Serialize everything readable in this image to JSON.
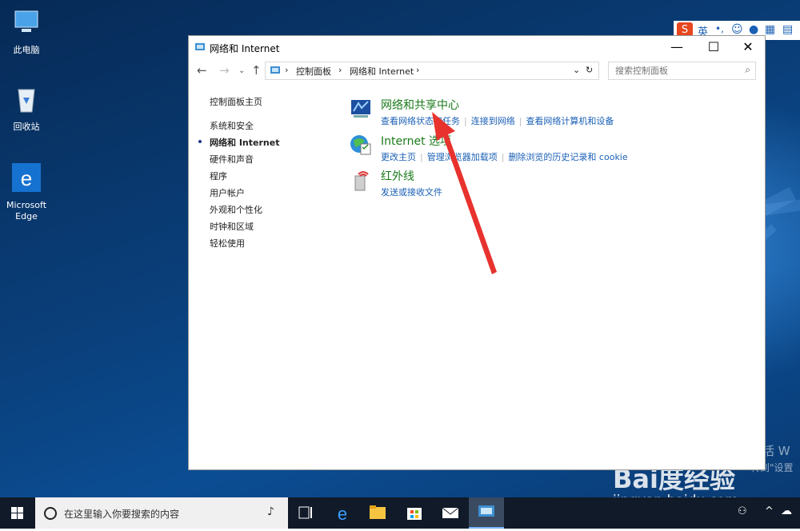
{
  "desktop": {
    "icons": [
      {
        "label": "此电脑",
        "icon": "computer-icon"
      },
      {
        "label": "回收站",
        "icon": "recycle-bin-icon"
      },
      {
        "label": "Microsoft Edge",
        "icon": "edge-icon"
      }
    ]
  },
  "window": {
    "title": "网络和 Internet",
    "controls": {
      "minimize": "—",
      "maximize": "☐",
      "close": "✕"
    },
    "breadcrumb": [
      "控制面板",
      "网络和 Internet"
    ],
    "search_placeholder": "搜索控制面板"
  },
  "sidebar": {
    "items": [
      {
        "label": "控制面板主页",
        "current": false
      },
      {
        "label": "系统和安全",
        "current": false
      },
      {
        "label": "网络和 Internet",
        "current": true
      },
      {
        "label": "硬件和声音",
        "current": false
      },
      {
        "label": "程序",
        "current": false
      },
      {
        "label": "用户帐户",
        "current": false
      },
      {
        "label": "外观和个性化",
        "current": false
      },
      {
        "label": "时钟和区域",
        "current": false
      },
      {
        "label": "轻松使用",
        "current": false
      }
    ]
  },
  "categories": [
    {
      "title": "网络和共享中心",
      "icon": "network-sharing-center-icon",
      "links": [
        "查看网络状态和任务",
        "连接到网络",
        "查看网络计算机和设备"
      ]
    },
    {
      "title": "Internet 选项",
      "icon": "internet-options-icon",
      "links": [
        "更改主页",
        "管理浏览器加载项",
        "删除浏览的历史记录和 cookie"
      ]
    },
    {
      "title": "红外线",
      "icon": "infrared-icon",
      "links": [
        "发送或接收文件"
      ]
    }
  ],
  "ime": {
    "lang": "英"
  },
  "watermarks": {
    "activate": "激活 W",
    "activate_sub": "转到\"设置",
    "baidu": "Bai度经验",
    "baidu_url": "jingyan.baidu.com"
  },
  "taskbar": {
    "search_placeholder": "在这里输入你要搜索的内容",
    "apps": [
      "task-view-icon",
      "edge-icon",
      "file-explorer-icon",
      "store-icon",
      "mail-icon",
      "control-panel-icon"
    ]
  },
  "colors": {
    "category_title": "#1b7a1b",
    "link": "#1a5fb4",
    "desktop": "#0a3f7a"
  }
}
